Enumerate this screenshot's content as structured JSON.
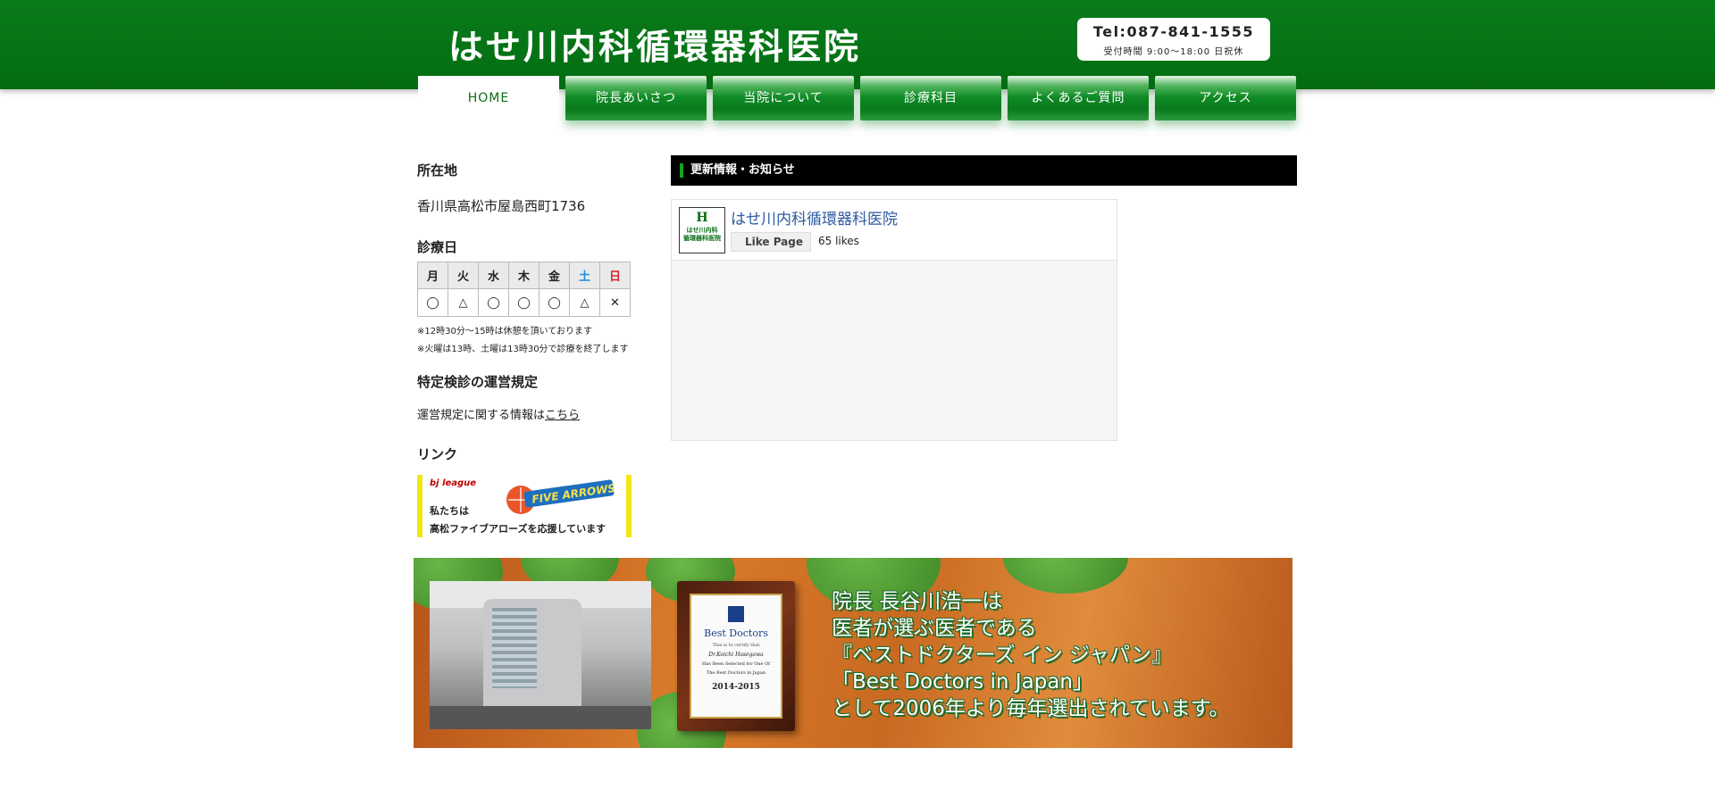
{
  "header": {
    "site_title": "はせ川内科循環器科医院",
    "tel": "Tel:087-841-1555",
    "hours": "受付時間 9:00〜18:00 日祝休"
  },
  "nav": {
    "tabs": [
      {
        "label": "HOME",
        "active": true
      },
      {
        "label": "院長あいさつ",
        "active": false
      },
      {
        "label": "当院について",
        "active": false
      },
      {
        "label": "診療科目",
        "active": false
      },
      {
        "label": "よくあるご質問",
        "active": false
      },
      {
        "label": "アクセス",
        "active": false
      }
    ]
  },
  "sidebar": {
    "location_heading": "所在地",
    "address": "香川県高松市屋島西町1736",
    "schedule_heading": "診療日",
    "days": [
      "月",
      "火",
      "水",
      "木",
      "金",
      "土",
      "日"
    ],
    "day_colors": {
      "sat": "#1a8fd6",
      "sun": "#d6242c"
    },
    "marks": [
      "◯",
      "△",
      "◯",
      "◯",
      "◯",
      "△",
      "✕"
    ],
    "note1": "※12時30分〜15時は休憩を頂いております",
    "note2": "※火曜は13時、土曜は13時30分で診療を終了します",
    "rules_heading": "特定検診の運営規定",
    "rules_text": "運営規定に関する情報は",
    "rules_link": "こちら",
    "links_heading": "リンク",
    "banner_line1": "私たちは",
    "banner_line2": "高松ファイブアローズを応援しています",
    "banner_logo_text": "bj league",
    "banner_arrows_text": "FIVE ARROWS"
  },
  "news": {
    "heading": "更新情報・お知らせ",
    "fb_page_name": "はせ川内科循環器科医院",
    "fb_logo_letter": "H",
    "fb_logo_text": "はせ川内科\n循環器科医院",
    "fb_like_label": "Like Page",
    "fb_likes": "65 likes"
  },
  "banner": {
    "lines": [
      "院長 長谷川浩一は",
      "医者が選ぶ医者である",
      "『ベストドクターズ イン ジャパン』",
      "「Best Doctors in Japan」",
      "として2006年より毎年選出されています。"
    ],
    "plaque_title": "Best Doctors",
    "plaque_small": "This is to certify that",
    "plaque_name": "Dr.Koichi Hasegawa",
    "plaque_list1": "Has Been Selected for One Of",
    "plaque_list2": "The Best Doctors in Japan",
    "plaque_year": "2014-2015"
  },
  "colors": {
    "header_green": "#047214",
    "nav_active_text": "#0a6e17",
    "news_bar": "#000000",
    "fb_link": "#2d5aa0"
  }
}
